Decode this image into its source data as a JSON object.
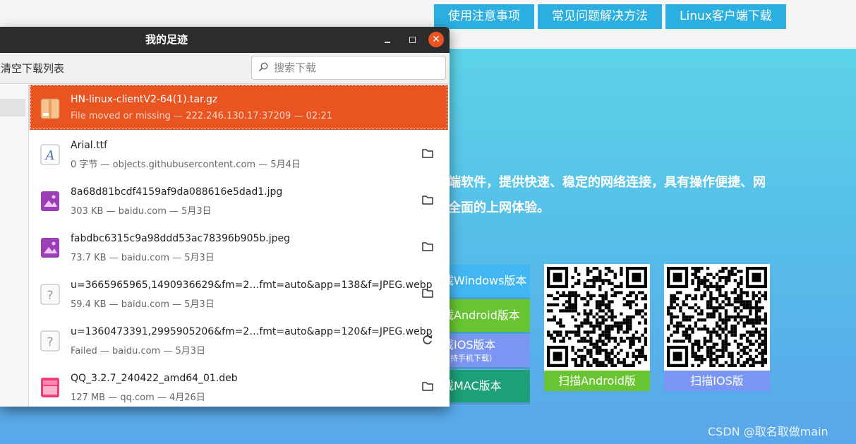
{
  "website": {
    "nav": [
      "使用注意事项",
      "常见问题解决方法",
      "Linux客户端下载"
    ],
    "hero_line1": "端软件，提供快速、稳定的网络连接，具有操作便捷、网",
    "hero_line2": "全面的上网体验。",
    "buttons": {
      "windows": "载Windows版本",
      "android": "载Android版本",
      "ios": "载IOS版本",
      "ios_sub": "支持手机下载）",
      "mac": "载MAC版本"
    },
    "qr_android_label": "扫描Android版",
    "qr_ios_label": "扫描IOS版",
    "watermark": "CSDN @取名取做main",
    "colors": {
      "nav": "#2baee0",
      "windows": "#42b6f2",
      "android": "#68c531",
      "ios": "#7b96f2",
      "mac": "#1d9f77"
    }
  },
  "window": {
    "title": "我的足迹",
    "clear_label": "清空下载列表",
    "search_placeholder": "搜索下载",
    "accent": "#e95420"
  },
  "downloads": [
    {
      "name": "HN-linux-clientV2-64(1).tar.gz",
      "meta": "File moved or missing — 222.246.130.17:37209 — 02:21",
      "icon": "archive-icon",
      "action": "",
      "selected": true
    },
    {
      "name": "Arial.ttf",
      "meta": "0 字节 — objects.githubusercontent.com — 5月4日",
      "icon": "font-icon",
      "action": "folder-icon"
    },
    {
      "name": "8a68d81bcdf4159af9da088616e5dad1.jpg",
      "meta": "303 KB — baidu.com — 5月3日",
      "icon": "image-icon",
      "action": "folder-icon"
    },
    {
      "name": "fabdbc6315c9a98ddd53ac78396b905b.jpeg",
      "meta": "73.7 KB — baidu.com — 5月3日",
      "icon": "image-icon",
      "action": "folder-icon"
    },
    {
      "name": "u=3665965965,1490936629&fm=2…fmt=auto&app=138&f=JPEG.webp",
      "meta": "59.4 KB — baidu.com — 5月3日",
      "icon": "unknown-file-icon",
      "action": "folder-icon"
    },
    {
      "name": "u=1360473391,2995905206&fm=2…fmt=auto&app=120&f=JPEG.webp",
      "meta": "Failed — baidu.com — 5月3日",
      "icon": "unknown-file-icon",
      "action": "retry-icon"
    },
    {
      "name": "QQ_3.2.7_240422_amd64_01.deb",
      "meta": "127 MB — qq.com — 4月26日",
      "icon": "package-icon",
      "action": "folder-icon"
    }
  ]
}
